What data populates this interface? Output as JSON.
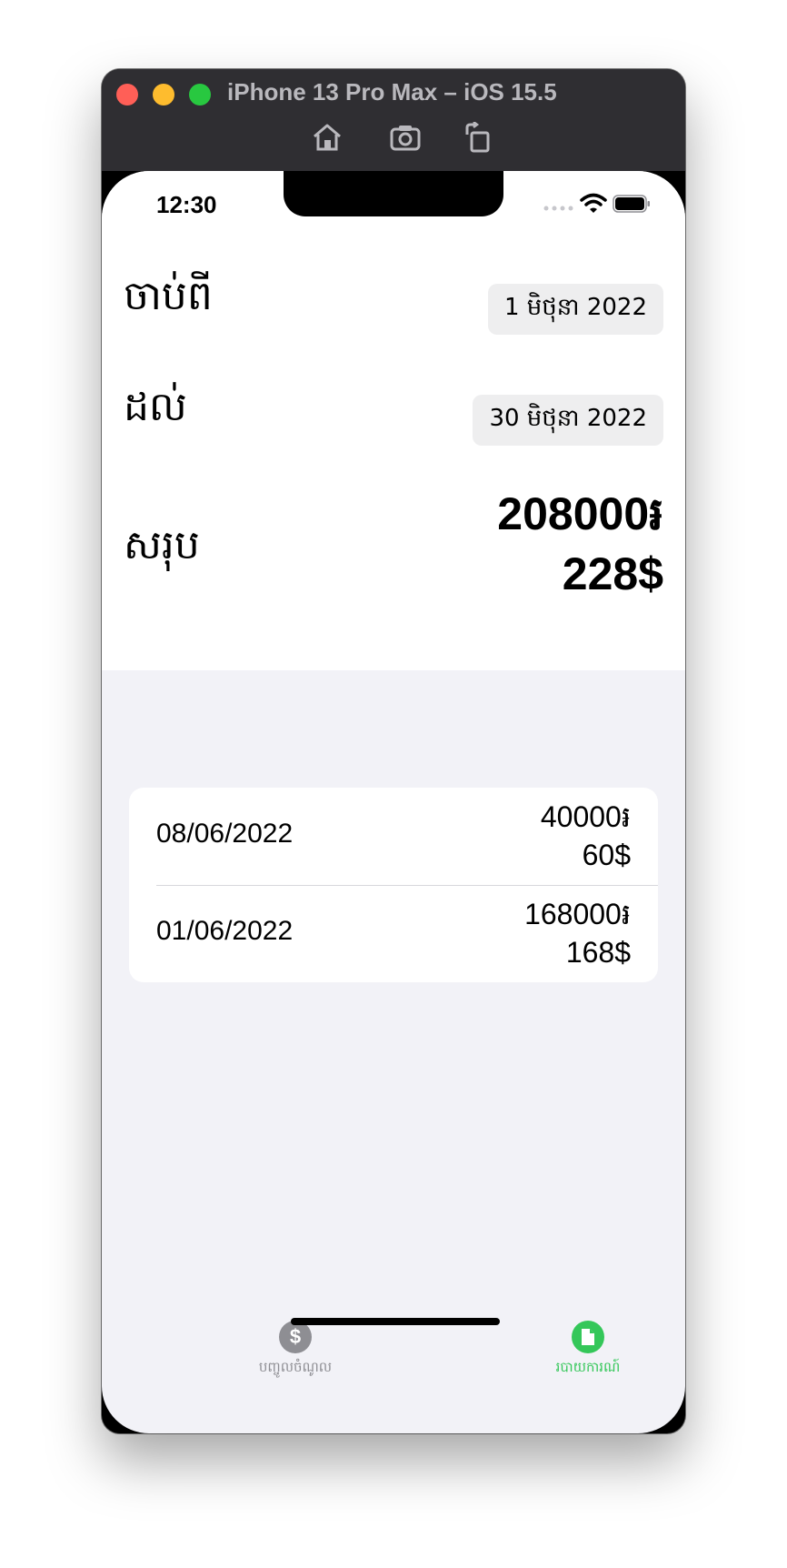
{
  "window": {
    "title": "iPhone 13 Pro Max – iOS 15.5"
  },
  "status_bar": {
    "time": "12:30"
  },
  "filter": {
    "from_label": "ចាប់ពី",
    "from_date": "1 មិថុនា 2022",
    "to_label": "ដល់",
    "to_date": "30 មិថុនា 2022"
  },
  "total": {
    "label": "សរុប",
    "riel": "208000៛",
    "usd": "228$"
  },
  "entries": [
    {
      "date": "08/06/2022",
      "riel": "40000៛",
      "usd": "60$"
    },
    {
      "date": "01/06/2022",
      "riel": "168000៛",
      "usd": "168$"
    }
  ],
  "tab_bar": {
    "items": [
      {
        "label": "បញ្ចូលចំណូល",
        "icon": "dollar-icon",
        "active": false
      },
      {
        "label": "របាយការណ៍",
        "icon": "document-icon",
        "active": true
      }
    ]
  },
  "colors": {
    "accent": "#34c759",
    "inactive": "#8e8e93"
  }
}
